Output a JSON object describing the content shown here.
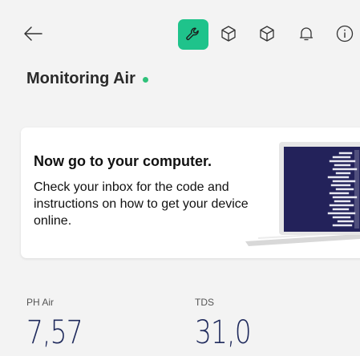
{
  "header": {
    "icons": [
      "back-arrow-icon",
      "wrench-icon",
      "cube-icon",
      "cube-icon",
      "bell-icon",
      "info-icon"
    ],
    "accent_color": "#1fc38b"
  },
  "device": {
    "title": "Monitoring Air",
    "status_color": "#2fc17a"
  },
  "card": {
    "title": "Now go to your computer.",
    "text": "Check your inbox for the code and instructions on how to get your device online."
  },
  "metrics": [
    {
      "label": "PH Air",
      "value": "7,57"
    },
    {
      "label": "TDS",
      "value": "31,0"
    }
  ]
}
